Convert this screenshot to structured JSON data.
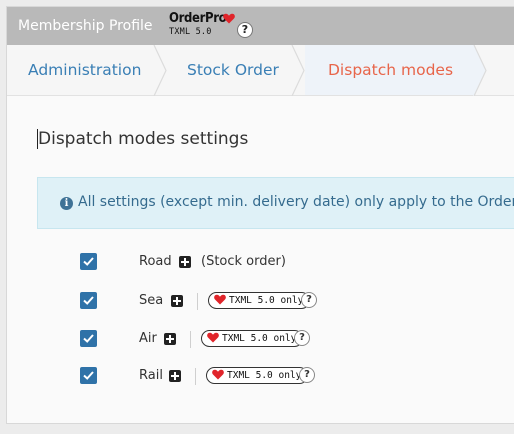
{
  "header": {
    "title": "Membership Profile",
    "logo": {
      "name": "OrderPro",
      "version": "TXML 5.0"
    },
    "help_label": "?"
  },
  "breadcrumb": {
    "tabs": [
      {
        "label": "Administration",
        "active": false
      },
      {
        "label": "Stock Order",
        "active": false
      },
      {
        "label": "Dispatch modes",
        "active": true
      }
    ]
  },
  "section": {
    "title": "Dispatch modes settings",
    "info_icon": "info-icon",
    "info_text": "All settings (except min. delivery date) only apply to the Order Pro b"
  },
  "modes": [
    {
      "label": "Road",
      "checked": true,
      "note": "(Stock order)",
      "badge": null
    },
    {
      "label": "Sea",
      "checked": true,
      "note": null,
      "badge": "TXML 5.0 only"
    },
    {
      "label": "Air",
      "checked": true,
      "note": null,
      "badge": "TXML 5.0 only"
    },
    {
      "label": "Rail",
      "checked": true,
      "note": null,
      "badge": "TXML 5.0 only"
    }
  ],
  "help_mark": "?",
  "colors": {
    "header_bg": "#b9b9b9",
    "link": "#3a7fb5",
    "active_tab": "#e8654a",
    "info_bg": "#dff1f7",
    "checkbox": "#2f72a8",
    "heart": "#e0252b"
  }
}
